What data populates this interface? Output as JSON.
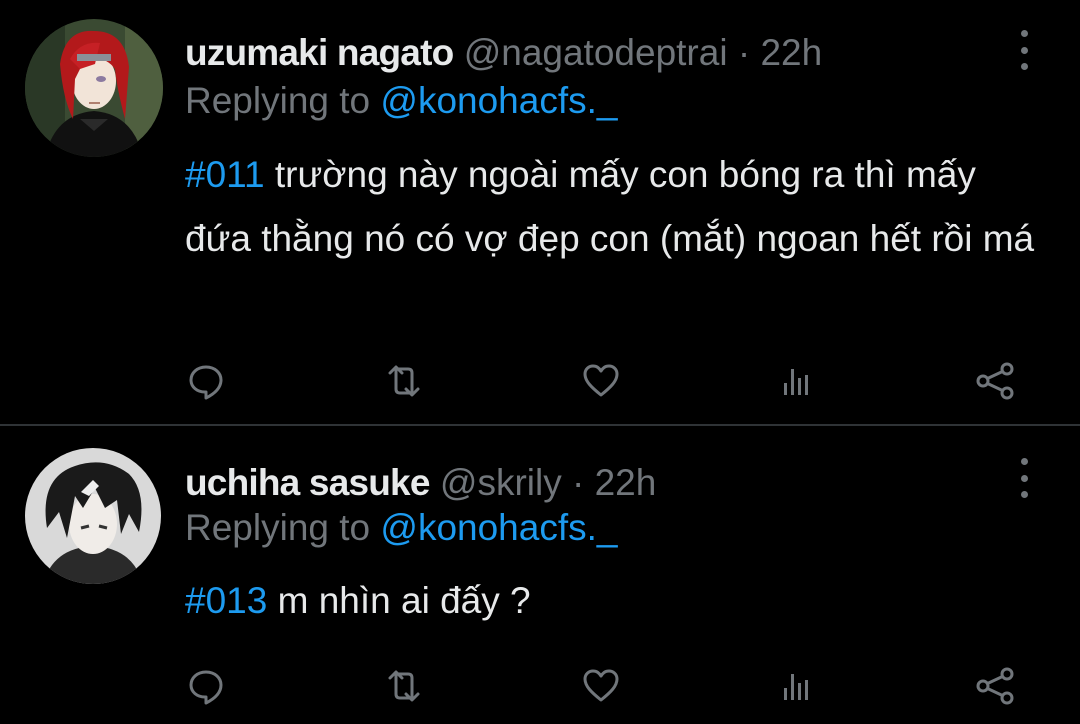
{
  "colors": {
    "background": "#000000",
    "primary_text": "#e7e9ea",
    "secondary_text": "#71767b",
    "accent": "#1d9bf0",
    "divider": "#2f3336"
  },
  "tweets": [
    {
      "display_name": "uzumaki nagato",
      "handle": "@nagatodeptrai",
      "separator": "·",
      "time": "22h",
      "replying_prefix": "Replying to",
      "replying_to": "@konohacfs._",
      "hashtag": "#011",
      "body": "trường này ngoài mấy con bóng ra thì mấy đứa thằng nó có vợ đẹp con (mắt) ngoan hết rồi má",
      "avatar": "red-haired anime character avatar",
      "actions": [
        "reply-icon",
        "retweet-icon",
        "like-icon",
        "views-icon",
        "share-icon"
      ],
      "more_icon": "more-vertical-icon"
    },
    {
      "display_name": "uchiha sasuke",
      "handle": "@skrily",
      "separator": "·",
      "time": "22h",
      "replying_prefix": "Replying to",
      "replying_to": "@konohacfs._",
      "hashtag": "#013",
      "body": "m nhìn ai đấy ?",
      "avatar": "dark-haired anime character avatar",
      "actions": [
        "reply-icon",
        "retweet-icon",
        "like-icon",
        "views-icon",
        "share-icon"
      ],
      "more_icon": "more-vertical-icon"
    }
  ]
}
